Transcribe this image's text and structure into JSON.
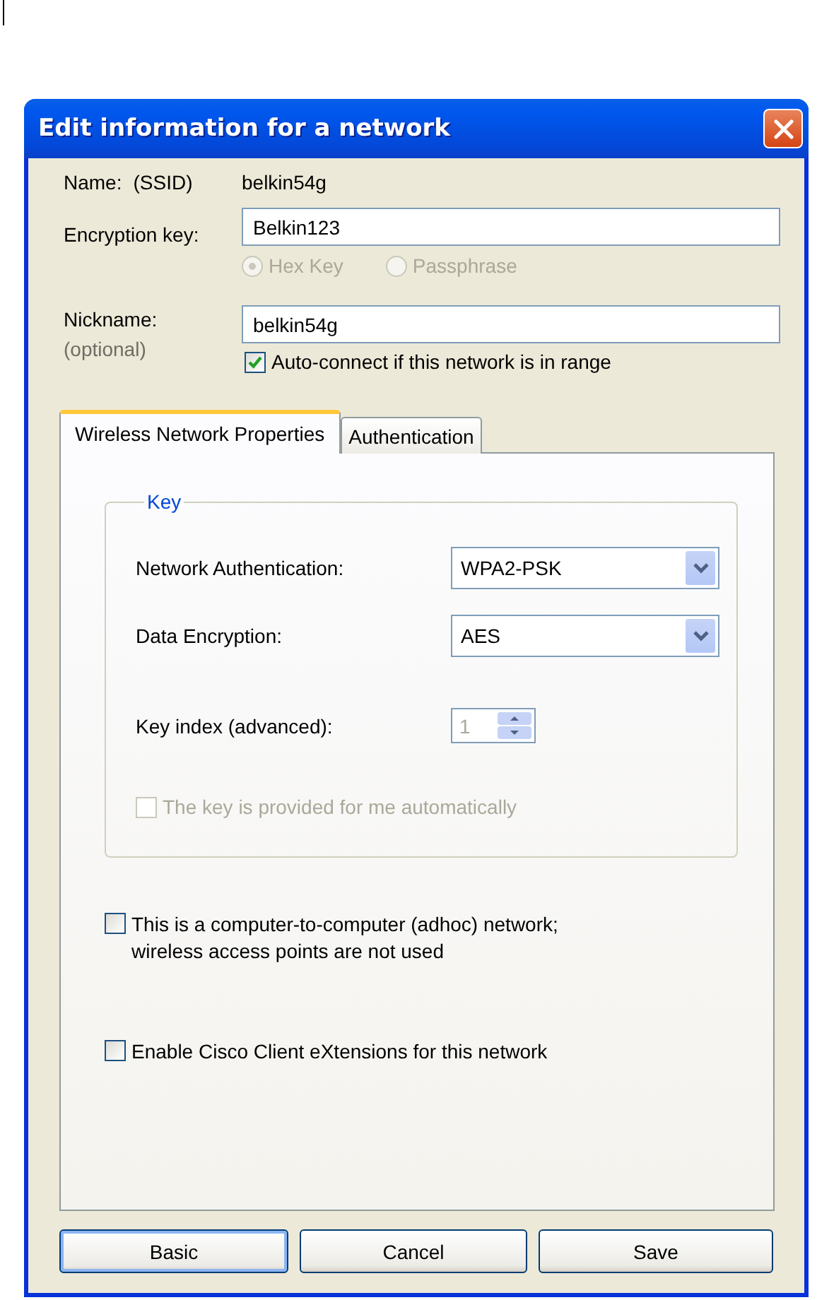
{
  "window": {
    "title": "Edit information for a network"
  },
  "name": {
    "label": "Name:",
    "qualifier": "(SSID)",
    "value": "belkin54g"
  },
  "encryption_key": {
    "label": "Encryption key:",
    "value": "Belkin123"
  },
  "key_type": [
    {
      "label": "Hex Key",
      "selected": true,
      "disabled": true
    },
    {
      "label": "Passphrase",
      "selected": false,
      "disabled": true
    }
  ],
  "nickname": {
    "label": "Nickname:",
    "hint": "(optional)",
    "value": "belkin54g"
  },
  "auto_connect": {
    "label": "Auto-connect if this network is in range",
    "checked": true
  },
  "tabs": [
    {
      "label": "Wireless Network Properties",
      "selected": true
    },
    {
      "label": "Authentication",
      "selected": false
    }
  ],
  "key_group": {
    "title": "Key",
    "fields": [
      {
        "kind": "select",
        "label": "Network Authentication:",
        "value": "WPA2-PSK"
      },
      {
        "kind": "select",
        "label": "Data Encryption:",
        "value": "AES"
      },
      {
        "kind": "spin",
        "label": "Key index (advanced):",
        "value": "1",
        "disabled": true
      }
    ],
    "auto_key": {
      "label": "The key is provided for me automatically",
      "checked": false,
      "disabled": true
    }
  },
  "options": [
    {
      "lines": [
        "This is a computer-to-computer (adhoc) network;",
        "wireless access points are not used"
      ],
      "checked": false
    },
    {
      "lines": [
        "Enable Cisco Client eXtensions for this network"
      ],
      "checked": false
    }
  ],
  "buttons": [
    {
      "label": "Basic",
      "default": true
    },
    {
      "label": "Cancel",
      "default": false
    },
    {
      "label": "Save",
      "default": false
    }
  ]
}
